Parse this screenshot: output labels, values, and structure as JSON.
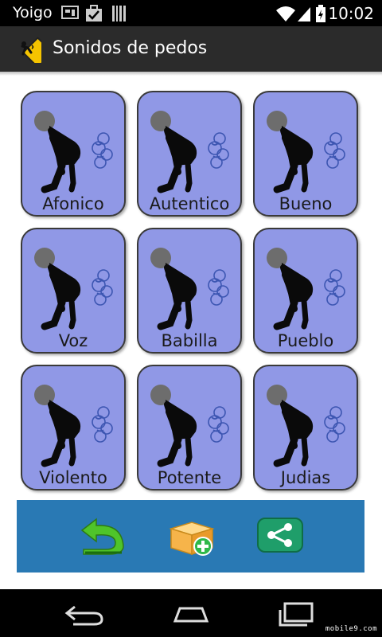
{
  "status_bar": {
    "carrier": "Yoigo",
    "time": "10:02"
  },
  "app": {
    "title": "Sonidos de pedos"
  },
  "sounds": [
    "Afonico",
    "Autentico",
    "Bueno",
    "Voz",
    "Babilla",
    "Pueblo",
    "Violento",
    "Potente",
    "Judias"
  ],
  "toolbar": {
    "buttons": [
      "back-arrow-icon",
      "add-box-icon",
      "share-icon"
    ]
  },
  "nav": {
    "buttons": [
      "back-icon",
      "home-icon",
      "recents-icon"
    ]
  },
  "watermark": "mobile9.com",
  "colors": {
    "tile": "#9098e6",
    "toolbar": "#2979b4",
    "actionbar": "#2b2b2b"
  }
}
